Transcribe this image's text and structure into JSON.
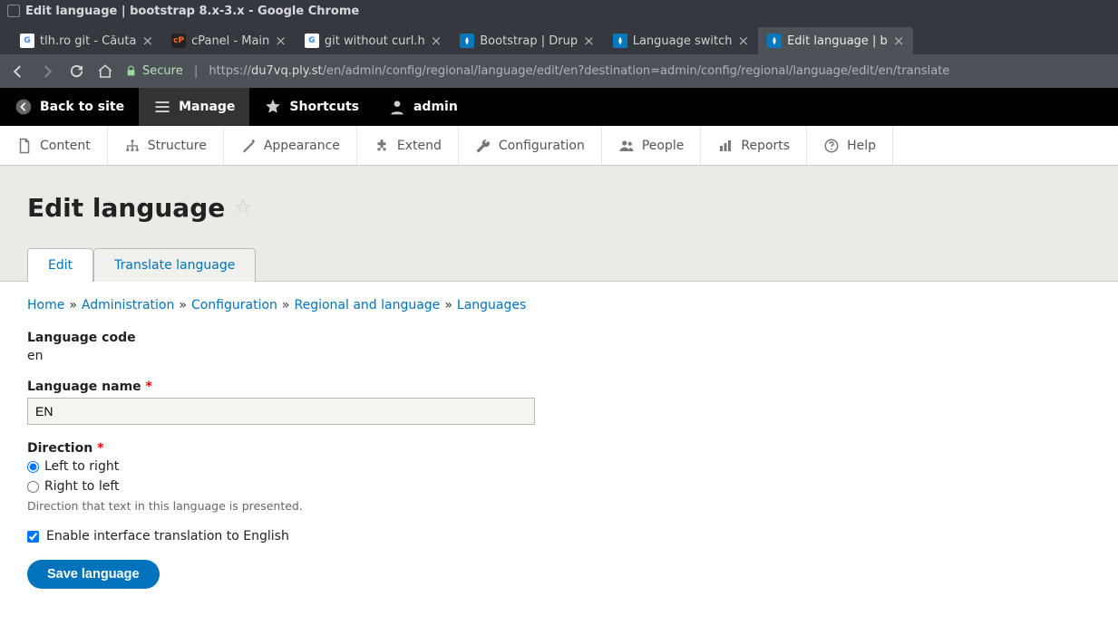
{
  "window": {
    "title": "Edit language | bootstrap 8.x-3.x - Google Chrome"
  },
  "tabs": [
    {
      "title": "tlh.ro git - Căuta",
      "favicon_bg": "#fff",
      "favicon_text": "G",
      "favicon_color": "#4285f4"
    },
    {
      "title": "cPanel - Main",
      "favicon_bg": "#222",
      "favicon_text": "cP",
      "favicon_color": "#ff6c2c"
    },
    {
      "title": "git without curl.h",
      "favicon_bg": "#fff",
      "favicon_text": "G",
      "favicon_color": "#4285f4"
    },
    {
      "title": "Bootstrap | Drup",
      "favicon_bg": "#0678be",
      "favicon_text": "",
      "favicon_color": "#fff"
    },
    {
      "title": "Language switch",
      "favicon_bg": "#0678be",
      "favicon_text": "",
      "favicon_color": "#fff"
    },
    {
      "title": "Edit language | b",
      "favicon_bg": "#0678be",
      "favicon_text": "",
      "favicon_color": "#fff",
      "active": true
    }
  ],
  "addressbar": {
    "secure_label": "Secure",
    "url_prefix": "https://",
    "url_host": "du7vq.ply.st",
    "url_path": "/en/admin/config/regional/language/edit/en?destination=admin/config/regional/language/edit/en/translate"
  },
  "admin_toolbar": {
    "back_to_site": "Back to site",
    "manage": "Manage",
    "shortcuts": "Shortcuts",
    "user": "admin"
  },
  "admin_menu": [
    {
      "label": "Content",
      "icon": "file"
    },
    {
      "label": "Structure",
      "icon": "structure"
    },
    {
      "label": "Appearance",
      "icon": "appearance"
    },
    {
      "label": "Extend",
      "icon": "extend"
    },
    {
      "label": "Configuration",
      "icon": "wrench"
    },
    {
      "label": "People",
      "icon": "people"
    },
    {
      "label": "Reports",
      "icon": "reports"
    },
    {
      "label": "Help",
      "icon": "help"
    }
  ],
  "page": {
    "title": "Edit language",
    "tabs": [
      {
        "label": "Edit",
        "active": true
      },
      {
        "label": "Translate language"
      }
    ],
    "breadcrumb": [
      "Home",
      "Administration",
      "Configuration",
      "Regional and language",
      "Languages"
    ]
  },
  "form": {
    "language_code_label": "Language code",
    "language_code_value": "en",
    "language_name_label": "Language name",
    "language_name_value": "EN",
    "direction_label": "Direction",
    "direction_options": [
      "Left to right",
      "Right to left"
    ],
    "direction_selected": 0,
    "direction_description": "Direction that text in this language is presented.",
    "enable_translation_label": "Enable interface translation to English",
    "enable_translation_checked": true,
    "submit_label": "Save language"
  }
}
